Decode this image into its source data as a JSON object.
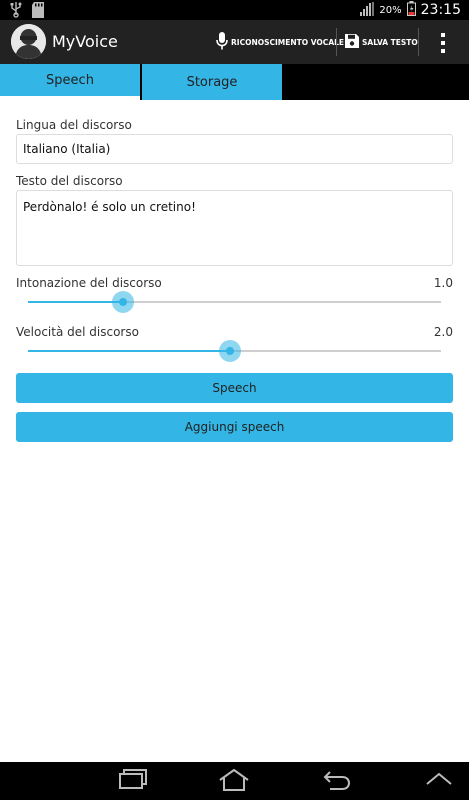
{
  "status_bar": {
    "battery_percent": "20%",
    "time": "23:15"
  },
  "action_bar": {
    "title": "MyVoice",
    "voice_action_label": "RICONOSCIMENTO VOCALE",
    "save_action_label": "SALVA TESTO"
  },
  "tabs": [
    {
      "label": "Speech",
      "selected": true
    },
    {
      "label": "Storage",
      "selected": false
    }
  ],
  "form": {
    "language_label": "Lingua del discorso",
    "language_value": "Italiano (Italia)",
    "text_label": "Testo del discorso",
    "text_value": "Perdònalo! é solo un cretino!",
    "pitch_label": "Intonazione del discorso",
    "pitch_value": "1.0",
    "pitch_fraction": 0.23,
    "speed_label": "Velocità del discorso",
    "speed_value": "2.0",
    "speed_fraction": 0.49
  },
  "buttons": {
    "speech_label": "Speech",
    "add_speech_label": "Aggiungi speech"
  },
  "colors": {
    "accent": "#33b5e5",
    "action_bar": "#222222",
    "status_bar": "#000000"
  },
  "icons": {
    "usb": "usb-icon",
    "sd_card": "sd-card-icon",
    "signal": "signal-icon",
    "battery": "battery-icon",
    "microphone": "microphone-icon",
    "save": "floppy-disk-icon",
    "overflow": "overflow-menu-icon",
    "recents": "recents-icon",
    "home": "home-icon",
    "back": "back-icon",
    "up": "chevron-up-icon"
  }
}
